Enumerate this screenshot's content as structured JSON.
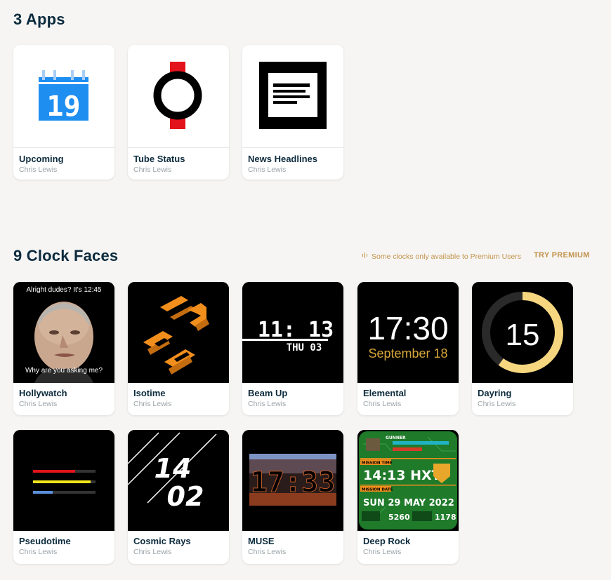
{
  "apps_section": {
    "title": "3 Apps"
  },
  "apps": [
    {
      "name": "Upcoming",
      "author": "Chris Lewis",
      "icon_day": "19"
    },
    {
      "name": "Tube Status",
      "author": "Chris Lewis"
    },
    {
      "name": "News Headlines",
      "author": "Chris Lewis"
    }
  ],
  "clock_section": {
    "title": "9 Clock Faces",
    "premium_note": "Some clocks only available to Premium Users",
    "try_premium": "TRY PREMIUM"
  },
  "clock_faces": [
    {
      "name": "Hollywatch",
      "author": "Chris Lewis",
      "top_text": "Alright dudes? It's 12:45",
      "bottom_text": "Why are you asking me?"
    },
    {
      "name": "Isotime",
      "author": "Chris Lewis"
    },
    {
      "name": "Beam Up",
      "author": "Chris Lewis",
      "time": "11: 13",
      "date": "THU 03"
    },
    {
      "name": "Elemental",
      "author": "Chris Lewis",
      "time": "17:30",
      "date": "September 18"
    },
    {
      "name": "Dayring",
      "author": "Chris Lewis",
      "value": "15",
      "ring_fraction": 0.6
    },
    {
      "name": "Pseudotime",
      "author": "Chris Lewis"
    },
    {
      "name": "Cosmic Rays",
      "author": "Chris Lewis",
      "hour": "14",
      "minute": "02"
    },
    {
      "name": "MUSE",
      "author": "Chris Lewis",
      "time": "17:33"
    },
    {
      "name": "Deep Rock",
      "author": "Chris Lewis",
      "rank": "GUNNER",
      "mission_time_label": "MISSION TIME",
      "mission_time": "14:13 HXT",
      "mission_date_label": "MISSION DATE",
      "mission_date": "SUN 29 MAY 2022",
      "stat1": "5260",
      "stat2": "1178"
    }
  ],
  "colors": {
    "title": "#0c2b3d",
    "author": "#9ba3a8",
    "premium": "#c2924a",
    "calendar_blue": "#1f8ef1",
    "tube_red": "#e3131b",
    "dayring_yellow": "#f6d77f",
    "elemental_yellow": "#d7a63a"
  }
}
